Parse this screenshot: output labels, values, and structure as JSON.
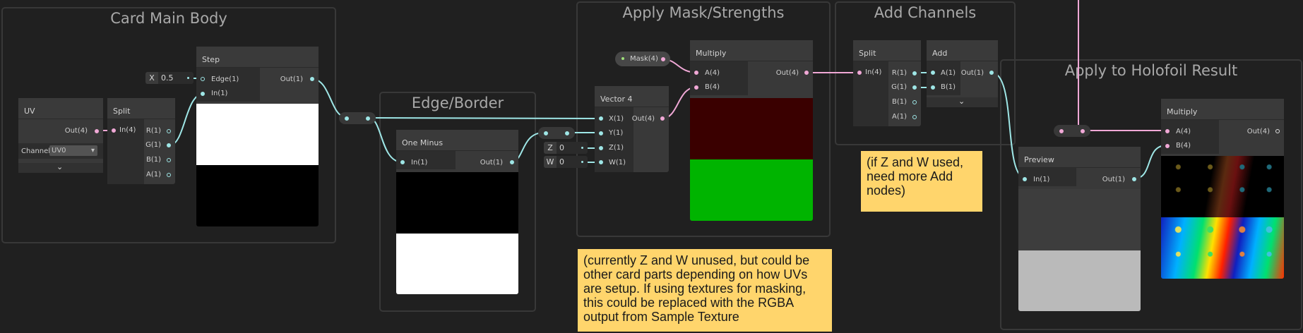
{
  "groups": {
    "card_main_body": "Card Main Body",
    "edge_border": "Edge/Border",
    "apply_mask": "Apply Mask/Strengths",
    "add_channels": "Add Channels",
    "apply_holofoil": "Apply to Holofoil Result"
  },
  "nodes": {
    "uv": {
      "title": "UV",
      "out": "Out(4)",
      "channel_label": "Channel",
      "channel_value": "UV0"
    },
    "split1": {
      "title": "Split",
      "in": "In(4)",
      "r": "R(1)",
      "g": "G(1)",
      "b": "B(1)",
      "a": "A(1)"
    },
    "step": {
      "title": "Step",
      "edge": "Edge(1)",
      "in": "In(1)",
      "out": "Out(1)",
      "x_label": "X",
      "x_value": "0.5"
    },
    "one_minus": {
      "title": "One Minus",
      "in": "In(1)",
      "out": "Out(1)"
    },
    "vector4": {
      "title": "Vector 4",
      "x": "X(1)",
      "y": "Y(1)",
      "z": "Z(1)",
      "w": "W(1)",
      "out": "Out(4)",
      "z_label": "Z",
      "z_value": "0",
      "w_label": "W",
      "w_value": "0"
    },
    "mask_property": {
      "label": "Mask(4)"
    },
    "multiply1": {
      "title": "Multiply",
      "a": "A(4)",
      "b": "B(4)",
      "out": "Out(4)"
    },
    "split2": {
      "title": "Split",
      "in": "In(4)",
      "r": "R(1)",
      "g": "G(1)",
      "b": "B(1)",
      "a": "A(1)"
    },
    "add": {
      "title": "Add",
      "a": "A(1)",
      "b": "B(1)",
      "out": "Out(1)"
    },
    "preview": {
      "title": "Preview",
      "in": "In(1)",
      "out": "Out(1)"
    },
    "multiply2": {
      "title": "Multiply",
      "a": "A(4)",
      "b": "B(4)",
      "out": "Out(4)"
    }
  },
  "notes": {
    "add_note": "(if Z and W used, need more Add nodes)",
    "mask_note": "(currently Z and W unused, but could be other card parts depending on how UVs are setup. If using textures for masking, this could be replaced with the RGBA output from Sample Texture"
  },
  "colors": {
    "background": "#202020",
    "wire_float": "#9ee6e6",
    "wire_vector4": "#f0a8d6",
    "sticky": "#ffd56c",
    "preview_red": "#3a0000",
    "preview_green": "#00b400"
  }
}
